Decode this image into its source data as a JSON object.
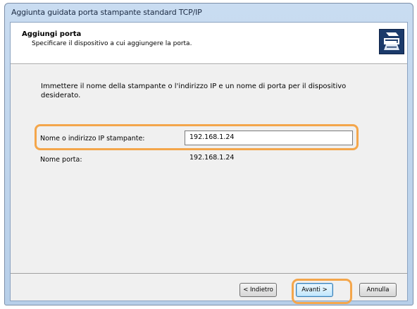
{
  "window": {
    "title": "Aggiunta guidata porta stampante standard TCP/IP"
  },
  "header": {
    "title": "Aggiungi porta",
    "subtitle": "Specificare il dispositivo a cui aggiungere la porta.",
    "icon": "printer-wizard-icon"
  },
  "body": {
    "instruction": "Immettere il nome della stampante o l'indirizzo IP e un nome di porta per il dispositivo desiderato.",
    "fields": {
      "printer_name_label": "Nome o indirizzo IP stampante:",
      "printer_name_value": "192.168.1.24",
      "port_name_label": "Nome porta:",
      "port_name_value": "192.168.1.24"
    }
  },
  "buttons": {
    "back": "< Indietro",
    "next": "Avanti >",
    "cancel": "Annulla"
  },
  "colors": {
    "highlight": "#f4a64b",
    "icon_bg": "#1b3a6a"
  }
}
